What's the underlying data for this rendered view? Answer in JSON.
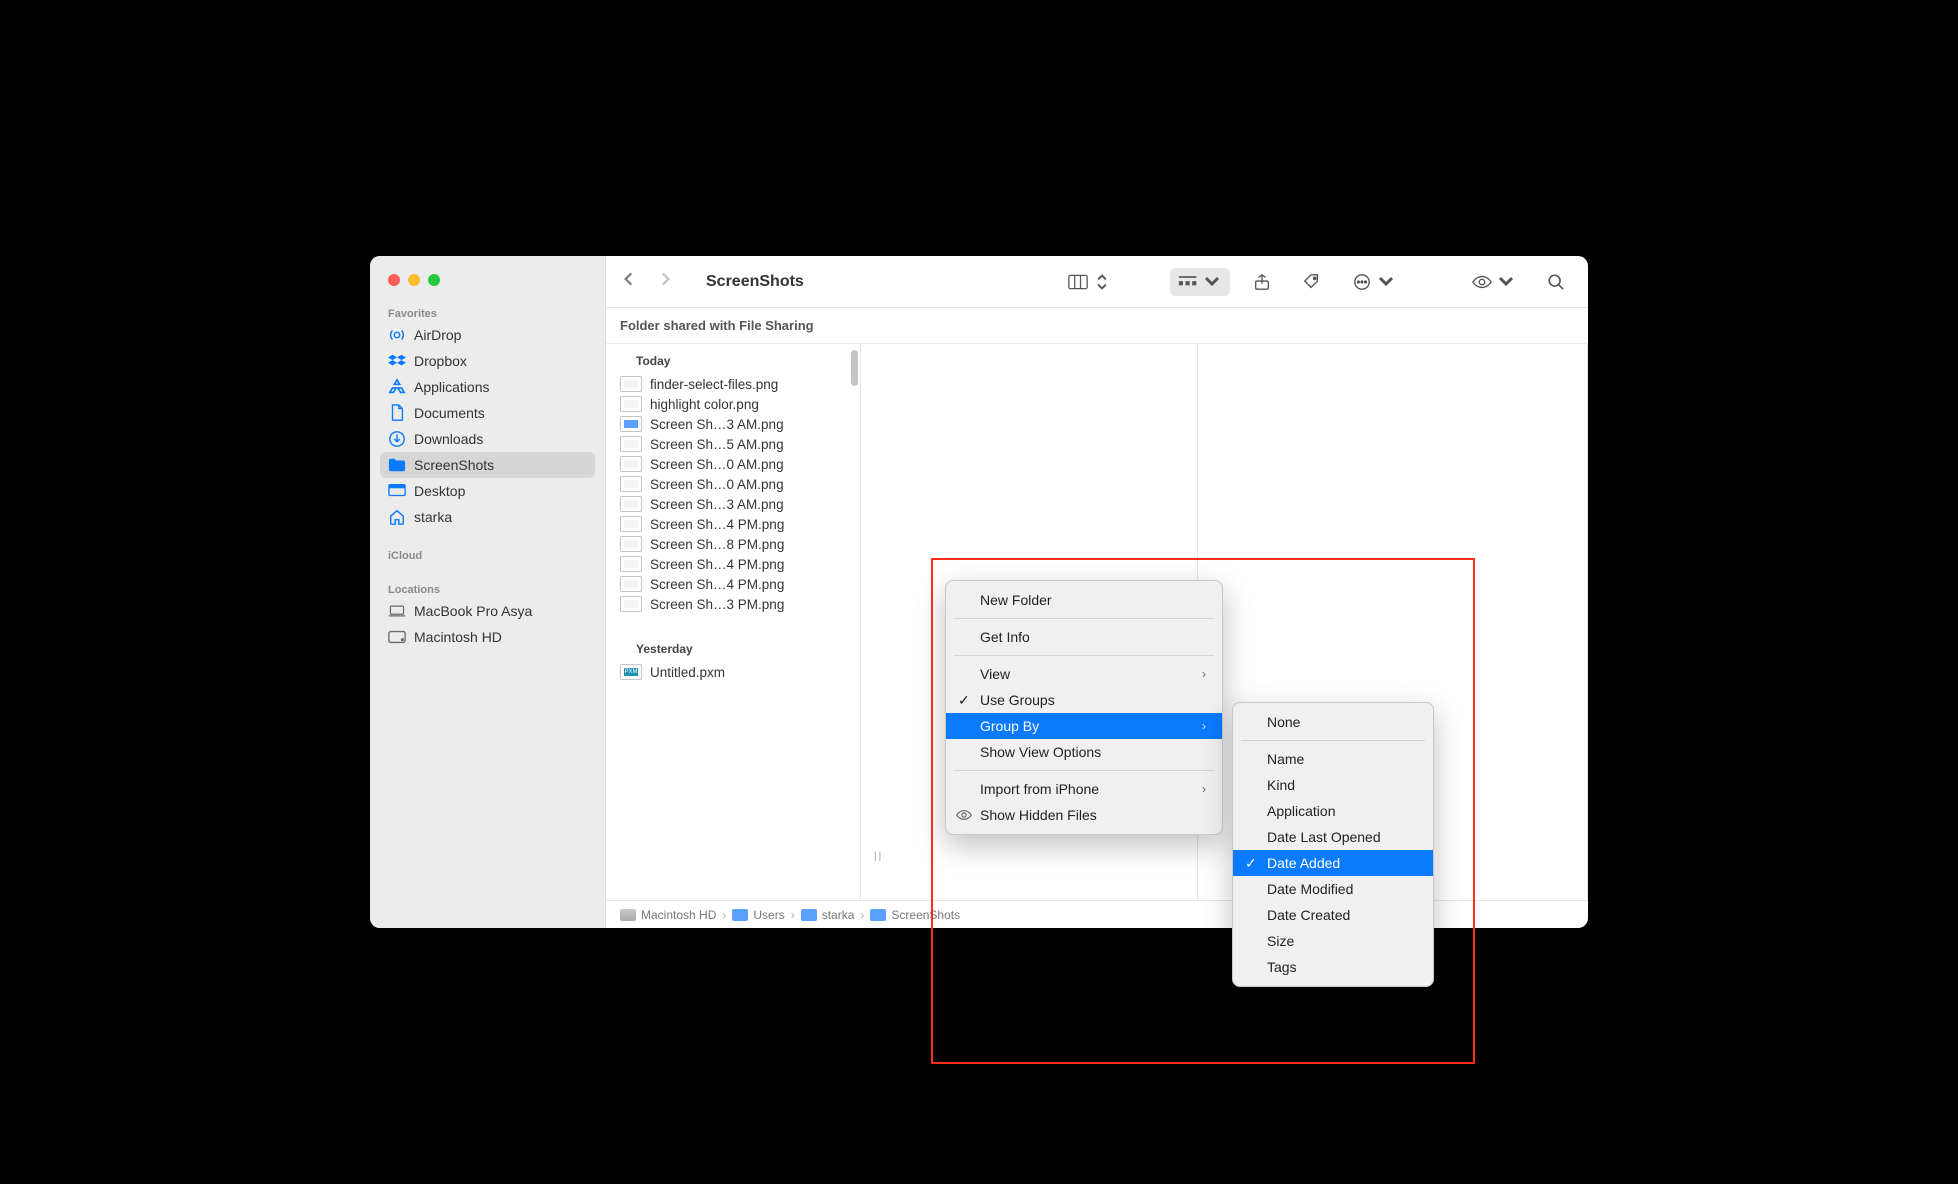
{
  "window": {
    "title": "ScreenShots",
    "infobar": "Folder shared with File Sharing"
  },
  "sidebar": {
    "sections": [
      {
        "header": "Favorites",
        "items": [
          {
            "label": "AirDrop",
            "icon": "airdrop"
          },
          {
            "label": "Dropbox",
            "icon": "dropbox"
          },
          {
            "label": "Applications",
            "icon": "apps"
          },
          {
            "label": "Documents",
            "icon": "doc"
          },
          {
            "label": "Downloads",
            "icon": "down"
          },
          {
            "label": "ScreenShots",
            "icon": "folder",
            "selected": true
          },
          {
            "label": "Desktop",
            "icon": "desktop"
          },
          {
            "label": "starka",
            "icon": "home"
          }
        ]
      },
      {
        "header": "iCloud",
        "items": []
      },
      {
        "header": "Locations",
        "items": [
          {
            "label": "MacBook Pro Asya",
            "icon": "laptop",
            "gray": true
          },
          {
            "label": "Macintosh HD",
            "icon": "disk",
            "gray": true
          }
        ]
      }
    ]
  },
  "groups": [
    {
      "header": "Today",
      "files": [
        {
          "name": "finder-select-files.png"
        },
        {
          "name": "highlight color.png"
        },
        {
          "name": "Screen Sh…3 AM.png",
          "blue": true
        },
        {
          "name": "Screen Sh…5 AM.png"
        },
        {
          "name": "Screen Sh…0 AM.png"
        },
        {
          "name": "Screen Sh…0 AM.png"
        },
        {
          "name": "Screen Sh…3 AM.png"
        },
        {
          "name": "Screen Sh…4 PM.png"
        },
        {
          "name": "Screen Sh…8 PM.png"
        },
        {
          "name": "Screen Sh…4 PM.png"
        },
        {
          "name": "Screen Sh…4 PM.png"
        },
        {
          "name": "Screen Sh…3 PM.png"
        }
      ]
    },
    {
      "header": "Yesterday",
      "files": [
        {
          "name": "Untitled.pxm",
          "teal": true
        }
      ]
    }
  ],
  "contextMenu": {
    "newFolder": "New Folder",
    "getInfo": "Get Info",
    "view": "View",
    "useGroups": "Use Groups",
    "groupBy": "Group By",
    "showViewOptions": "Show View Options",
    "importFromIphone": "Import from iPhone",
    "showHiddenFiles": "Show Hidden Files"
  },
  "groupBySubmenu": {
    "none": "None",
    "name": "Name",
    "kind": "Kind",
    "application": "Application",
    "dateLastOpened": "Date Last Opened",
    "dateAdded": "Date Added",
    "dateModified": "Date Modified",
    "dateCreated": "Date Created",
    "size": "Size",
    "tags": "Tags"
  },
  "path": [
    {
      "label": "Macintosh HD",
      "kind": "disk"
    },
    {
      "label": "Users",
      "kind": "fold"
    },
    {
      "label": "starka",
      "kind": "fold"
    },
    {
      "label": "ScreenShots",
      "kind": "fold"
    }
  ]
}
